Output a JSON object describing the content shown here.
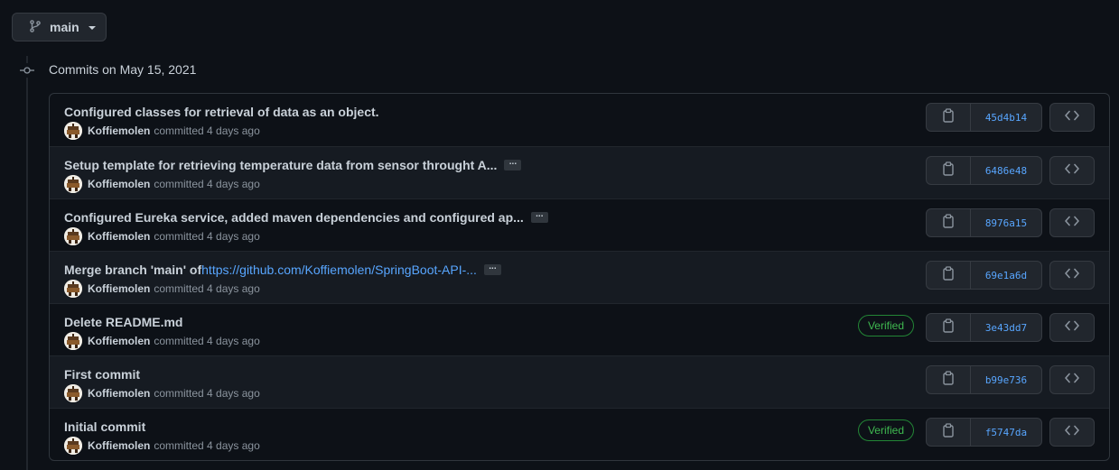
{
  "branch": {
    "name": "main",
    "icon": "git-branch-icon"
  },
  "timeline": {
    "heading": "Commits on May 15, 2021"
  },
  "commits": [
    {
      "message": "Configured classes for retrieval of data as an object.",
      "message_link": "",
      "truncated": false,
      "author": "Koffiemolen",
      "action": "committed",
      "time": "4 days ago",
      "verified": false,
      "sha": "45d4b14"
    },
    {
      "message": "Setup template for retrieving temperature data from sensor throught A...",
      "message_link": "",
      "truncated": true,
      "author": "Koffiemolen",
      "action": "committed",
      "time": "4 days ago",
      "verified": false,
      "sha": "6486e48"
    },
    {
      "message": "Configured Eureka service, added maven dependencies and configured ap...",
      "message_link": "",
      "truncated": true,
      "author": "Koffiemolen",
      "action": "committed",
      "time": "4 days ago",
      "verified": false,
      "sha": "8976a15"
    },
    {
      "message": "Merge branch 'main' of ",
      "message_link": "https://github.com/Koffiemolen/SpringBoot-API-...",
      "truncated": true,
      "author": "Koffiemolen",
      "action": "committed",
      "time": "4 days ago",
      "verified": false,
      "sha": "69e1a6d"
    },
    {
      "message": "Delete README.md",
      "message_link": "",
      "truncated": false,
      "author": "Koffiemolen",
      "action": "committed",
      "time": "4 days ago",
      "verified": true,
      "sha": "3e43dd7"
    },
    {
      "message": "First commit",
      "message_link": "",
      "truncated": false,
      "author": "Koffiemolen",
      "action": "committed",
      "time": "4 days ago",
      "verified": false,
      "sha": "b99e736"
    },
    {
      "message": "Initial commit",
      "message_link": "",
      "truncated": false,
      "author": "Koffiemolen",
      "action": "committed",
      "time": "4 days ago",
      "verified": true,
      "sha": "f5747da"
    }
  ],
  "labels": {
    "verified": "Verified",
    "ellipsis": "..."
  },
  "icons": {
    "copy": "clipboard-icon",
    "browse": "code-icon",
    "node": "git-commit-icon"
  },
  "colors": {
    "bg": "#0d1117",
    "link": "#58a6ff",
    "verified": "#3fb950"
  }
}
